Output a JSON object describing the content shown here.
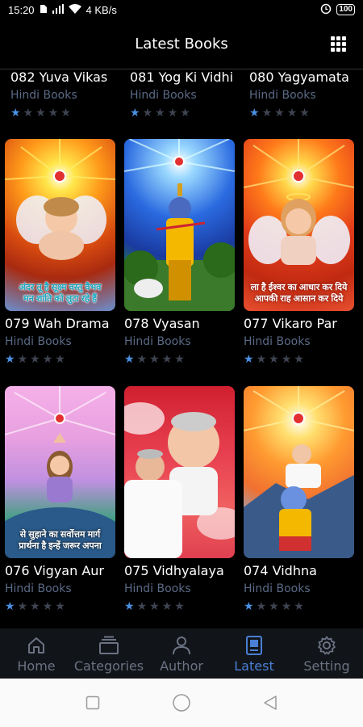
{
  "status_bar": {
    "time": "15:20",
    "network_speed": "4 KB/s",
    "battery": "100",
    "icons": [
      "sim-icon",
      "signal-icon",
      "wifi-icon",
      "alarm-icon",
      "battery-icon"
    ]
  },
  "header": {
    "title": "Latest Books",
    "right_icon": "grid-view-icon"
  },
  "books": [
    {
      "title": "082 Yuva Vikas",
      "category": "Hindi Books",
      "rating": 1,
      "max_rating": 5
    },
    {
      "title": "081 Yog Ki Vidhi",
      "category": "Hindi Books",
      "rating": 1,
      "max_rating": 5
    },
    {
      "title": "080 Yagyamata",
      "category": "Hindi Books",
      "rating": 1,
      "max_rating": 5
    },
    {
      "title": "079 Wah Drama",
      "category": "Hindi Books",
      "rating": 1,
      "max_rating": 5,
      "cover_text": [
        "अंदर तू है सूक्ष्म वस्तु वैभव",
        "मन शांति को लुटा रहे हैं",
        "अपने समान"
      ]
    },
    {
      "title": "078 Vyasan",
      "category": "Hindi Books",
      "rating": 1,
      "max_rating": 5
    },
    {
      "title": "077 Vikaro Par",
      "category": "Hindi Books",
      "rating": 1,
      "max_rating": 5,
      "cover_text": [
        "ला है ईश्वर का आधार कर दिये",
        "आपकी राह आसान कर दिये"
      ]
    },
    {
      "title": "076 Vigyan Aur",
      "category": "Hindi Books",
      "rating": 1,
      "max_rating": 5,
      "cover_text": [
        "से सुहाने का सर्वोत्तम मार्ग",
        "प्रार्थना है इन्हें जरूर अपना"
      ]
    },
    {
      "title": "075 Vidhyalaya",
      "category": "Hindi Books",
      "rating": 1,
      "max_rating": 5
    },
    {
      "title": "074 Vidhna",
      "category": "Hindi Books",
      "rating": 1,
      "max_rating": 5
    }
  ],
  "bottom_nav": [
    {
      "label": "Home",
      "icon": "home-icon",
      "active": false
    },
    {
      "label": "Categories",
      "icon": "categories-icon",
      "active": false
    },
    {
      "label": "Author",
      "icon": "author-icon",
      "active": false
    },
    {
      "label": "Latest",
      "icon": "latest-icon",
      "active": true
    },
    {
      "label": "Setting",
      "icon": "setting-icon",
      "active": false
    }
  ],
  "colors": {
    "active_nav": "#4a7fd4",
    "inactive_nav": "#6b7282",
    "category_text": "#5a6a86",
    "star_on": "#4a90e2",
    "star_off": "#3e4452"
  }
}
